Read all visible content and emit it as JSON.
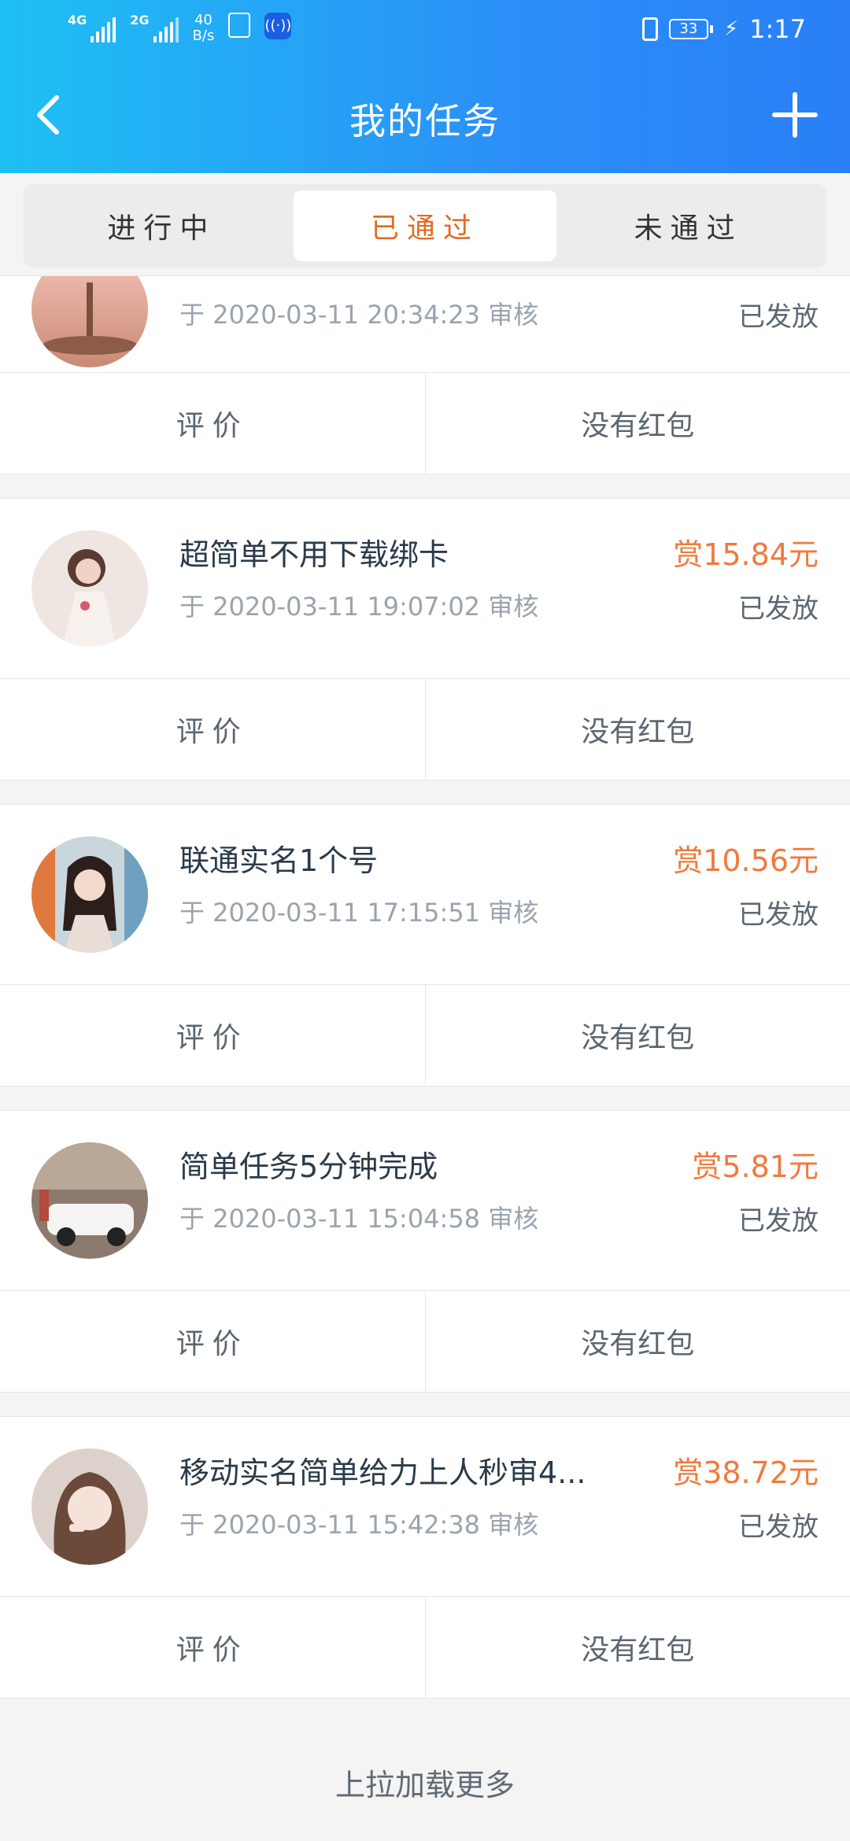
{
  "statusbar": {
    "net1": "4G",
    "net2": "2G",
    "speed_value": "40",
    "speed_unit": "B/s",
    "battery": "33",
    "time": "1:17"
  },
  "nav": {
    "title": "我的任务"
  },
  "tabs": [
    {
      "label": "进行中",
      "active": false
    },
    {
      "label": "已通过",
      "active": true
    },
    {
      "label": "未通过",
      "active": false
    }
  ],
  "tasks": [
    {
      "title": "",
      "meta": "于 2020-03-11 20:34:23 审核",
      "reward": "",
      "status": "已发放",
      "review_label": "评价",
      "redpack_label": "没有红包"
    },
    {
      "title": "超简单不用下载绑卡",
      "meta": "于 2020-03-11 19:07:02 审核",
      "reward": "赏15.84元",
      "status": "已发放",
      "review_label": "评价",
      "redpack_label": "没有红包"
    },
    {
      "title": "联通实名1个号",
      "meta": "于 2020-03-11 17:15:51 审核",
      "reward": "赏10.56元",
      "status": "已发放",
      "review_label": "评价",
      "redpack_label": "没有红包"
    },
    {
      "title": "简单任务5分钟完成",
      "meta": "于 2020-03-11 15:04:58 审核",
      "reward": "赏5.81元",
      "status": "已发放",
      "review_label": "评价",
      "redpack_label": "没有红包"
    },
    {
      "title": "移动实名简单给力上人秒审4...",
      "meta": "于 2020-03-11 15:42:38 审核",
      "reward": "赏38.72元",
      "status": "已发放",
      "review_label": "评价",
      "redpack_label": "没有红包"
    }
  ],
  "footer": {
    "load_more": "上拉加载更多"
  },
  "colors": {
    "header_gradient_start": "#1ec0f4",
    "header_gradient_end": "#2a7ff6",
    "active_tab": "#e26b22",
    "reward": "#f07a3c"
  }
}
